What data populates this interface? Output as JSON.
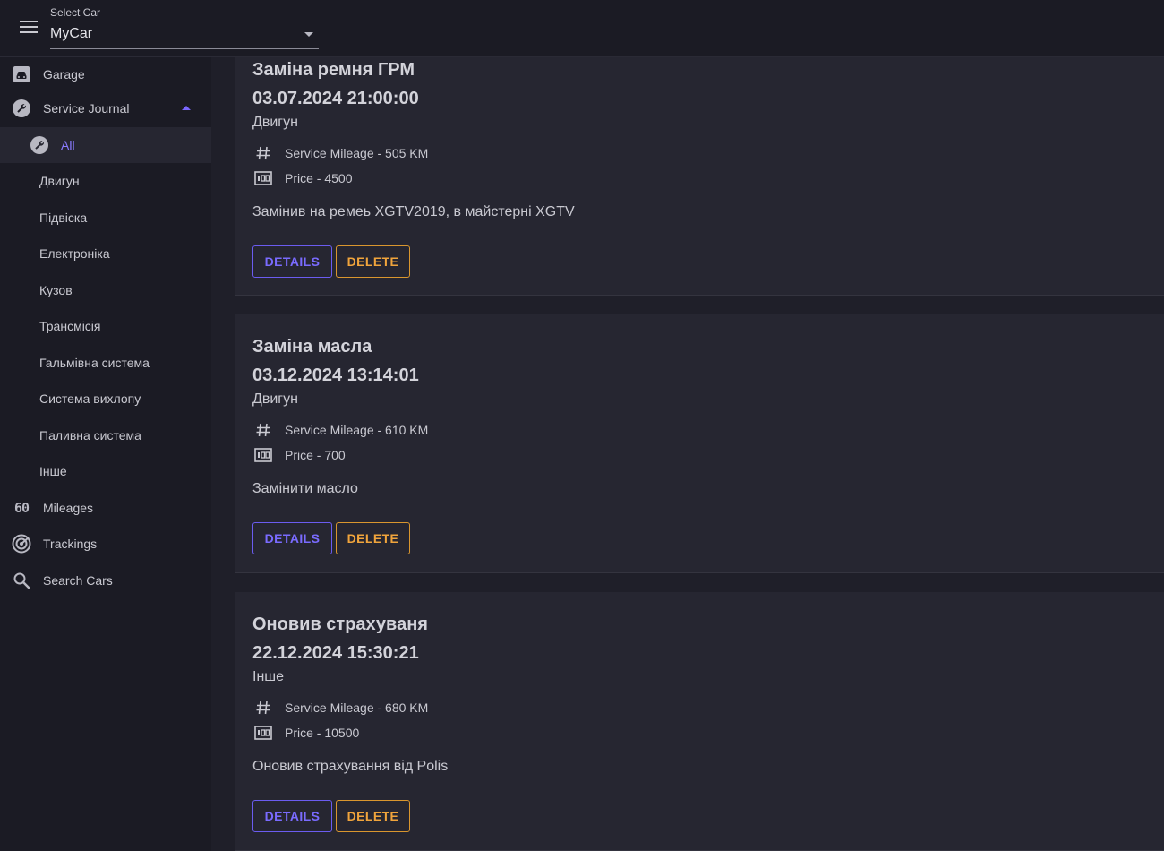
{
  "topbar": {
    "select_label": "Select Car",
    "select_value": "MyCar"
  },
  "sidebar": {
    "items": [
      {
        "label": "Garage",
        "icon": "garage-icon"
      },
      {
        "label": "Service Journal",
        "icon": "wrench-icon",
        "expanded": true
      },
      {
        "label": "Mileages",
        "icon": "mileage-icon",
        "icon_text": "60"
      },
      {
        "label": "Trackings",
        "icon": "tracking-icon"
      },
      {
        "label": "Search Cars",
        "icon": "search-icon"
      }
    ],
    "sub_items": [
      {
        "label": "All",
        "active": true
      },
      {
        "label": "Двигун"
      },
      {
        "label": "Підвіска"
      },
      {
        "label": "Електроніка"
      },
      {
        "label": "Кузов"
      },
      {
        "label": "Трансмісія"
      },
      {
        "label": "Гальмівна система"
      },
      {
        "label": "Система вихлопу"
      },
      {
        "label": "Паливна система"
      },
      {
        "label": "Інше"
      }
    ]
  },
  "records": [
    {
      "title": "Заміна ремня ГРМ",
      "date": "03.07.2024 21:00:00",
      "category": "Двигун",
      "mileage": "Service Mileage - 505 KM",
      "price": "Price - 4500",
      "description": "Замінив на ремеь XGTV2019, в майстерні XGTV",
      "details_label": "DETAILS",
      "delete_label": "DELETE"
    },
    {
      "title": "Заміна масла",
      "date": "03.12.2024 13:14:01",
      "category": "Двигун",
      "mileage": "Service Mileage - 610 KM",
      "price": "Price - 700",
      "description": "Замінити масло",
      "details_label": "DETAILS",
      "delete_label": "DELETE"
    },
    {
      "title": "Оновив страхуваня",
      "date": "22.12.2024 15:30:21",
      "category": "Інше",
      "mileage": "Service Mileage - 680 KM",
      "price": "Price - 10500",
      "description": "Оновив страхування від Polis",
      "details_label": "DETAILS",
      "delete_label": "DELETE"
    }
  ],
  "colors": {
    "accent": "#7a6bff",
    "danger": "#f0a43c",
    "background": "#1f1f29",
    "surface": "#262631"
  }
}
